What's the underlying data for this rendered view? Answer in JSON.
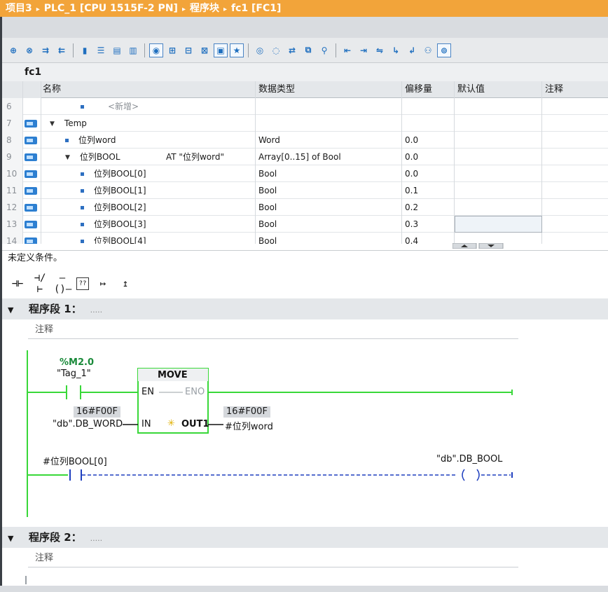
{
  "title_bar": {
    "breadcrumb": [
      "项目3",
      "PLC_1 [CPU 1515F-2 PN]",
      "程序块",
      "fc1 [FC1]"
    ],
    "separator": "▸"
  },
  "toolbar": {
    "buttons": [
      {
        "icon": "insert-row-icon",
        "glyph": "⊕"
      },
      {
        "icon": "delete-row-icon",
        "glyph": "⊗"
      },
      {
        "icon": "indent-icon",
        "glyph": "⇉"
      },
      {
        "icon": "outdent-icon",
        "glyph": "⇇"
      },
      {
        "icon": "separator-small-icon",
        "glyph": "▮"
      },
      {
        "icon": "list-view-icon",
        "glyph": "☰"
      },
      {
        "icon": "grid-view-icon",
        "glyph": "▤"
      },
      {
        "icon": "split-view-icon",
        "glyph": "▥"
      },
      {
        "icon": "comment-toggle-icon",
        "glyph": "◉"
      },
      {
        "icon": "network-expand-icon",
        "glyph": "⊞"
      },
      {
        "icon": "network-collapse-icon",
        "glyph": "⊟"
      },
      {
        "icon": "network-toggle-icon",
        "glyph": "⊠"
      },
      {
        "icon": "absolute-address-icon",
        "glyph": "▣"
      },
      {
        "icon": "favorites-icon",
        "glyph": "★"
      },
      {
        "icon": "monitor-on-icon",
        "glyph": "◎"
      },
      {
        "icon": "monitor-off-icon",
        "glyph": "◌"
      },
      {
        "icon": "crossref-icon",
        "glyph": "⇄"
      },
      {
        "icon": "watch-table-icon",
        "glyph": "⧉"
      },
      {
        "icon": "filter-icon",
        "glyph": "⚲"
      },
      {
        "icon": "goto-icon",
        "glyph": "⇤"
      },
      {
        "icon": "align-left-icon",
        "glyph": "⇥"
      },
      {
        "icon": "align-right-icon",
        "glyph": "⇋"
      },
      {
        "icon": "call-icon",
        "glyph": "↳"
      },
      {
        "icon": "return-icon",
        "glyph": "↲"
      },
      {
        "icon": "users-icon",
        "glyph": "⚇"
      },
      {
        "icon": "glasses-icon",
        "glyph": "⊚"
      }
    ]
  },
  "block": {
    "name": "fc1"
  },
  "interface": {
    "headers": {
      "name": "名称",
      "type": "数据类型",
      "offset": "偏移量",
      "default": "默认值",
      "comment": "注释"
    },
    "rows": [
      {
        "num": "6",
        "name": "<新增>",
        "type": "",
        "offset": "",
        "indent": 2,
        "marker": "bullet",
        "io": false,
        "placeholder": true
      },
      {
        "num": "7",
        "name": "Temp",
        "type": "",
        "offset": "",
        "indent": 0,
        "marker": "tri",
        "io": true
      },
      {
        "num": "8",
        "name": "位列word",
        "type": "Word",
        "offset": "0.0",
        "indent": 1,
        "marker": "bullet",
        "io": true
      },
      {
        "num": "9",
        "name": "位列BOOL",
        "type": "Array[0..15] of Bool",
        "offset": "0.0",
        "indent": 1,
        "marker": "tri",
        "io": true,
        "at": "AT \"位列word\""
      },
      {
        "num": "10",
        "name": "位列BOOL[0]",
        "type": "Bool",
        "offset": "0.0",
        "indent": 2,
        "marker": "bullet",
        "io": true
      },
      {
        "num": "11",
        "name": "位列BOOL[1]",
        "type": "Bool",
        "offset": "0.1",
        "indent": 2,
        "marker": "bullet",
        "io": true
      },
      {
        "num": "12",
        "name": "位列BOOL[2]",
        "type": "Bool",
        "offset": "0.2",
        "indent": 2,
        "marker": "bullet",
        "io": true
      },
      {
        "num": "13",
        "name": "位列BOOL[3]",
        "type": "Bool",
        "offset": "0.3",
        "indent": 2,
        "marker": "bullet",
        "io": true,
        "selected_default": true
      },
      {
        "num": "14",
        "name": "位列BOOL[4]",
        "type": "Bool",
        "offset": "0.4",
        "indent": 2,
        "marker": "bullet",
        "io": true
      }
    ]
  },
  "status": {
    "text": "未定义条件。"
  },
  "ladder_toolbar": {
    "items": [
      {
        "name": "no-contact-icon",
        "glyph": "⊣⊢"
      },
      {
        "name": "nc-contact-icon",
        "glyph": "⊣/⊢"
      },
      {
        "name": "coil-icon",
        "glyph": "–()–"
      },
      {
        "name": "empty-box-icon",
        "glyph": "??"
      },
      {
        "name": "open-branch-icon",
        "glyph": "↦"
      },
      {
        "name": "close-branch-icon",
        "glyph": "↥"
      }
    ]
  },
  "networks": [
    {
      "caret": "▼",
      "title": "程序段 1：",
      "dots": ".....",
      "comment": "注释"
    },
    {
      "caret": "▼",
      "title": "程序段 2：",
      "dots": ".....",
      "comment": "注释"
    }
  ],
  "ladder": {
    "contact_addr": "%M2.0",
    "contact_tag": "\"Tag_1\"",
    "box_title": "MOVE",
    "en": "EN",
    "eno": "ENO",
    "in_label": "IN",
    "out_label": "OUT1",
    "in_value": "16#F00F",
    "in_operand": "\"db\".DB_WORD",
    "out_value": "16#F00F",
    "out_operand": "#位列word",
    "contact2_operand": "#位列BOOL[0]",
    "coil2_operand": "\"db\".DB_BOOL",
    "colors": {
      "power": "#39d839",
      "box_border": "#39d839",
      "dashed": "#1f3fbf"
    }
  }
}
